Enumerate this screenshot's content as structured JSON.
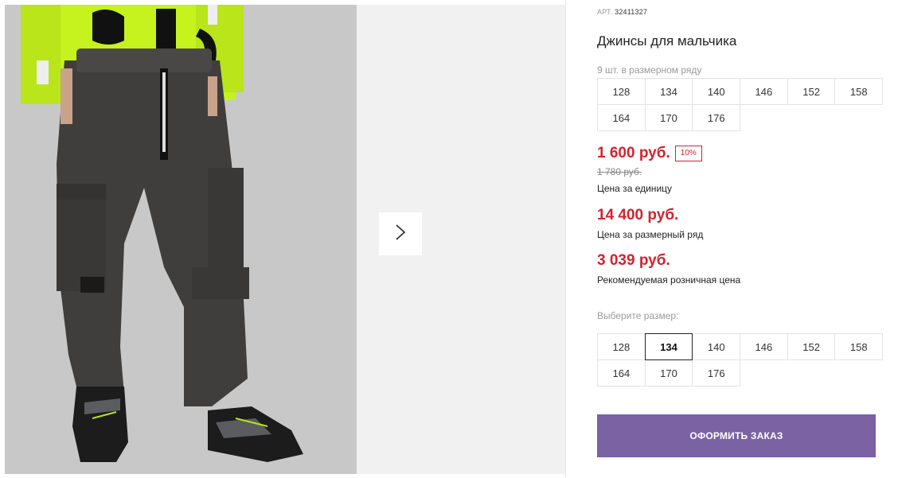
{
  "product": {
    "article_label": "АРТ.",
    "article_number": "32411327",
    "title": "Джинсы для мальчика"
  },
  "size_row": {
    "caption": "9 шт. в размерном ряду",
    "sizes": [
      "128",
      "134",
      "140",
      "146",
      "152",
      "158",
      "164",
      "170",
      "176"
    ]
  },
  "prices": {
    "unit_price": "1 600 руб.",
    "discount_badge": "10%",
    "old_price": "1 780 руб.",
    "unit_label": "Цена за единицу",
    "row_price": "14 400 руб.",
    "row_label": "Цена за размерный ряд",
    "rrp_price": "3 039 руб.",
    "rrp_label": "Рекомендуемая розничная цена"
  },
  "size_select": {
    "caption": "Выберите размер:",
    "sizes": [
      "128",
      "134",
      "140",
      "146",
      "152",
      "158",
      "164",
      "170",
      "176"
    ],
    "selected": "134"
  },
  "order_button": "ОФОРМИТЬ ЗАКАЗ",
  "colors": {
    "accent_red": "#d3222e",
    "button_purple": "#7a62a3",
    "shirt_lime": "#c6f21e"
  },
  "icons": {
    "next_arrow": "chevron-right-icon"
  }
}
